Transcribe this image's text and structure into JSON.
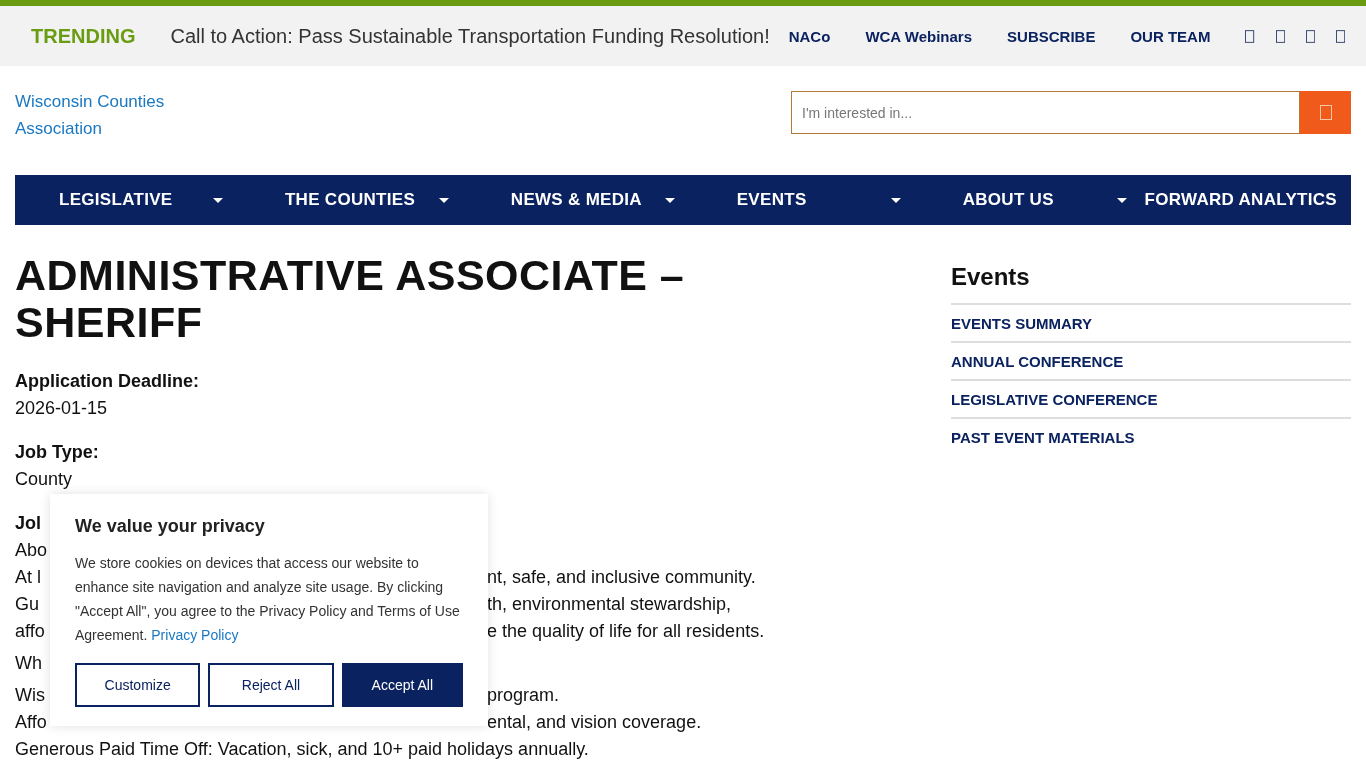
{
  "top_bar": {
    "trending_label": "TRENDING",
    "trending_link": "Call to Action: Pass Sustainable Transportation Funding Resolution!",
    "links": [
      "NACo",
      "WCA Webinars",
      "SUBSCRIBE",
      "OUR TEAM"
    ]
  },
  "logo": {
    "alt_text": "Wisconsin Counties Association"
  },
  "search": {
    "placeholder": "I'm interested in..."
  },
  "nav": [
    {
      "label": "LEGISLATIVE",
      "has_dropdown": true
    },
    {
      "label": "THE COUNTIES",
      "has_dropdown": true
    },
    {
      "label": "NEWS & MEDIA",
      "has_dropdown": true
    },
    {
      "label": "EVENTS",
      "has_dropdown": true
    },
    {
      "label": "ABOUT US",
      "has_dropdown": true
    },
    {
      "label": "FORWARD ANALYTICS",
      "has_dropdown": false
    }
  ],
  "article": {
    "title": "ADMINISTRATIVE ASSOCIATE – SHERIFF",
    "fields": [
      {
        "label": "Application Deadline:",
        "value": "2026-01-15"
      },
      {
        "label": "Job Type:",
        "value": "County"
      }
    ],
    "lines": [
      {
        "kind": "heading",
        "start": "Jol"
      },
      {
        "kind": "text",
        "start": "Abo"
      },
      {
        "kind": "text",
        "start": "At l",
        "end": "nt, safe, and inclusive community."
      },
      {
        "kind": "text",
        "start": "Gu",
        "end": "th, environmental stewardship,"
      },
      {
        "kind": "text",
        "start": "affo",
        "end": "e the quality of life for all residents."
      },
      {
        "kind": "gap",
        "start": "Wh"
      },
      {
        "kind": "text",
        "start": "Wis",
        "end": "program."
      },
      {
        "kind": "text",
        "start": "Affo",
        "end": "ental, and vision coverage."
      },
      {
        "kind": "text",
        "start": "Generous Paid Time Off: Vacation, sick, and 10+ paid holidays annually."
      }
    ]
  },
  "sidebar": {
    "title": "Events",
    "links": [
      "EVENTS SUMMARY",
      "ANNUAL CONFERENCE",
      "LEGISLATIVE CONFERENCE",
      "PAST EVENT MATERIALS"
    ]
  },
  "cookie_banner": {
    "title": "We value your privacy",
    "text": "We store cookies on devices that access our website to enhance site navigation and analyze site usage. By clicking \"Accept All\", you agree to the Privacy Policy and Terms of Use Agreement.",
    "link": "Privacy Policy",
    "buttons": [
      {
        "label": "Customize",
        "kind": "outline"
      },
      {
        "label": "Reject All",
        "kind": "outline"
      },
      {
        "label": "Accept All",
        "kind": "primary"
      }
    ]
  }
}
